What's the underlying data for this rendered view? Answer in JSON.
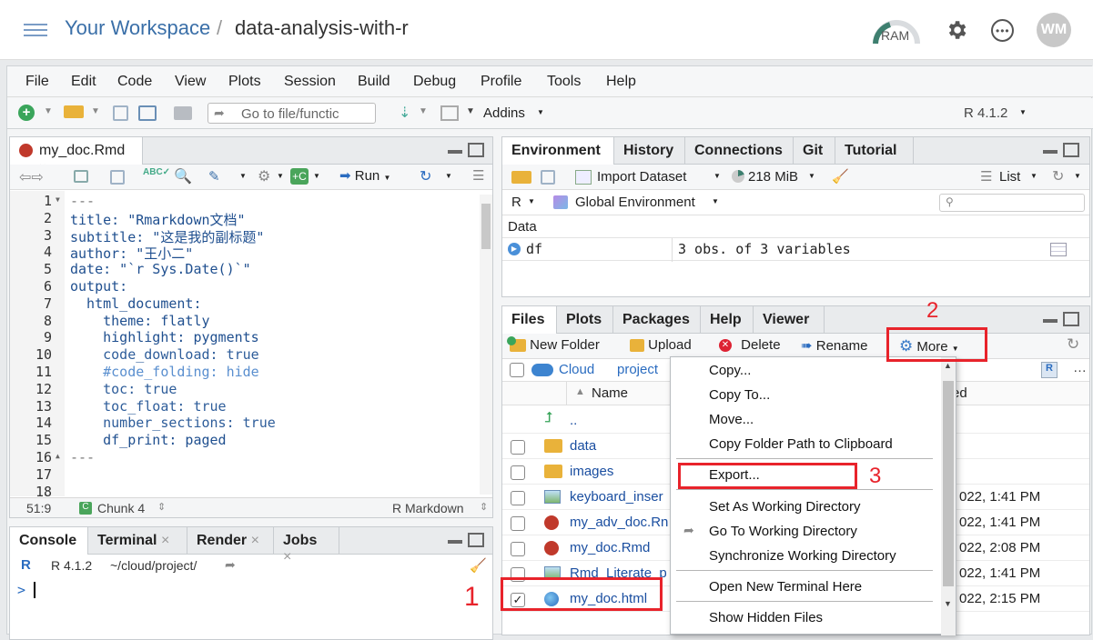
{
  "header": {
    "workspace": "Your Workspace",
    "separator": "/",
    "project": "data-analysis-with-r",
    "ram_label": "RAM",
    "avatar": "WM"
  },
  "menubar": [
    "File",
    "Edit",
    "Code",
    "View",
    "Plots",
    "Session",
    "Build",
    "Debug",
    "Profile",
    "Tools",
    "Help"
  ],
  "toolbar": {
    "goto_placeholder": "Go to file/functic",
    "addins": "Addins",
    "r_version": "R 4.1.2"
  },
  "editor": {
    "tab": "my_doc.Rmd",
    "run": "Run",
    "lines": [
      {
        "n": "1",
        "t": "---"
      },
      {
        "n": "2",
        "t": "title: \"Rmarkdown文档\""
      },
      {
        "n": "3",
        "t": "subtitle: \"这是我的副标题\""
      },
      {
        "n": "4",
        "t": "author: \"王小二\""
      },
      {
        "n": "5",
        "t": "date: \"`r Sys.Date()`\""
      },
      {
        "n": "6",
        "t": "output:"
      },
      {
        "n": "7",
        "t": "  html_document:"
      },
      {
        "n": "8",
        "t": "    theme: flatly"
      },
      {
        "n": "9",
        "t": "    highlight: pygments"
      },
      {
        "n": "10",
        "t": "    code_download: true"
      },
      {
        "n": "11",
        "t": "    #code_folding: hide"
      },
      {
        "n": "12",
        "t": "    toc: true"
      },
      {
        "n": "13",
        "t": "    toc_float: true"
      },
      {
        "n": "14",
        "t": "    number_sections: true"
      },
      {
        "n": "15",
        "t": "    df_print: paged"
      },
      {
        "n": "16",
        "t": "---"
      },
      {
        "n": "17",
        "t": ""
      },
      {
        "n": "18",
        "t": ""
      }
    ],
    "status_pos": "51:9",
    "status_chunk": "Chunk 4",
    "status_mode": "R Markdown"
  },
  "console": {
    "tabs": [
      "Console",
      "Terminal",
      "Render",
      "Jobs"
    ],
    "rversion": "R 4.1.2",
    "path": "~/cloud/project/",
    "prompt": ">"
  },
  "env": {
    "tabs": [
      "Environment",
      "History",
      "Connections",
      "Git",
      "Tutorial"
    ],
    "import": "Import Dataset",
    "mem": "218 MiB",
    "list": "List",
    "lang": "R",
    "scope": "Global Environment",
    "section": "Data",
    "var_name": "df",
    "var_desc": "3 obs. of 3 variables"
  },
  "files": {
    "tabs": [
      "Files",
      "Plots",
      "Packages",
      "Help",
      "Viewer"
    ],
    "new_folder": "New Folder",
    "upload": "Upload",
    "delete": "Delete",
    "rename": "Rename",
    "more": "More",
    "crumb_cloud": "Cloud",
    "crumb_project": "project",
    "col_name": "Name",
    "col_modified_tail": "ed",
    "rows": [
      {
        "name": "..",
        "date": ""
      },
      {
        "name": "data",
        "date": ""
      },
      {
        "name": "images",
        "date": ""
      },
      {
        "name": "keyboard_inser",
        "date": "022, 1:41 PM"
      },
      {
        "name": "my_adv_doc.Rn",
        "date": "022, 1:41 PM"
      },
      {
        "name": "my_doc.Rmd",
        "date": "022, 2:08 PM"
      },
      {
        "name": "Rmd_Literate_p",
        "date": "022, 1:41 PM"
      },
      {
        "name": "my_doc.html",
        "date": "022, 2:15 PM"
      }
    ]
  },
  "context_menu": {
    "items": [
      "Copy...",
      "Copy To...",
      "Move...",
      "Copy Folder Path to Clipboard",
      "Export...",
      "Set As Working Directory",
      "Go To Working Directory",
      "Synchronize Working Directory",
      "Open New Terminal Here",
      "Show Hidden Files"
    ]
  },
  "annotations": [
    "1",
    "2",
    "3"
  ],
  "colors": {
    "accent": "#3a6fa8",
    "highlight_red": "#e8232b",
    "link": "#1a4ea0"
  }
}
